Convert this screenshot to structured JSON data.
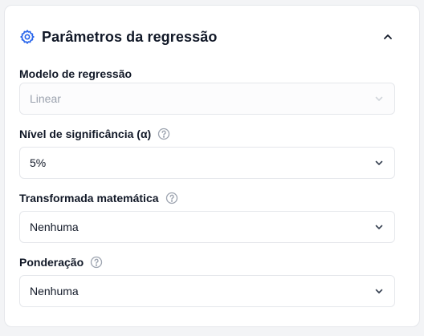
{
  "panel": {
    "title": "Parâmetros da regressão",
    "header_icon": "gear-icon",
    "collapse_icon": "chevron-up-icon",
    "accent_color": "#2563eb"
  },
  "fields": [
    {
      "label": "Modelo de regressão",
      "value": "Linear",
      "disabled": true,
      "help": false
    },
    {
      "label": "Nível de significância (α)",
      "value": "5%",
      "disabled": false,
      "help": true
    },
    {
      "label": "Transformada matemática",
      "value": "Nenhuma",
      "disabled": false,
      "help": true
    },
    {
      "label": "Ponderação",
      "value": "Nenhuma",
      "disabled": false,
      "help": true
    }
  ]
}
